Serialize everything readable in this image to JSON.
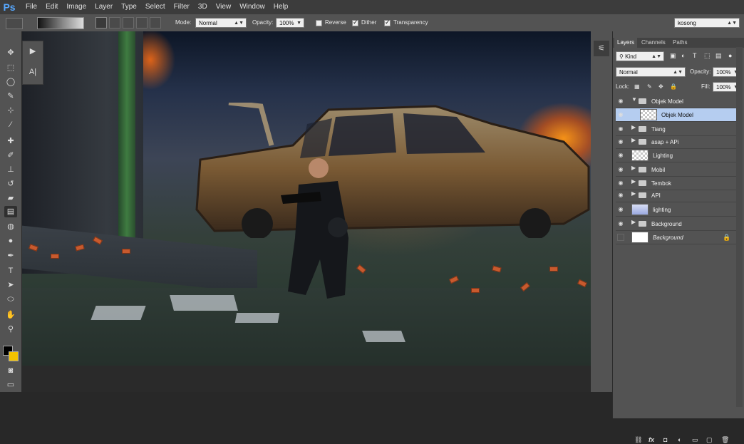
{
  "app": {
    "logo": "Ps"
  },
  "menu": [
    "File",
    "Edit",
    "Image",
    "Layer",
    "Type",
    "Select",
    "Filter",
    "3D",
    "View",
    "Window",
    "Help"
  ],
  "options": {
    "mode_label": "Mode:",
    "mode_value": "Normal",
    "opacity_label": "Opacity:",
    "opacity_value": "100%",
    "reverse_label": "Reverse",
    "dither_label": "Dither",
    "transparency_label": "Transparency",
    "reverse_checked": false,
    "dither_checked": true,
    "transparency_checked": true,
    "workspace_value": "kosong"
  },
  "layers_panel": {
    "tabs": [
      "Layers",
      "Channels",
      "Paths"
    ],
    "filter_value": "Kind",
    "blend_value": "Normal",
    "opacity_label": "Opacity:",
    "opacity_value": "100%",
    "lock_label": "Lock:",
    "fill_label": "Fill:",
    "fill_value": "100%",
    "layers": [
      {
        "name": "Objek Model",
        "type": "group",
        "expanded": true,
        "visible": true,
        "indent": 0
      },
      {
        "name": "Objek Model",
        "type": "layer",
        "selected": true,
        "visible": true,
        "indent": 1
      },
      {
        "name": "Tiang",
        "type": "group",
        "visible": true,
        "indent": 0
      },
      {
        "name": "asap + APi",
        "type": "group",
        "visible": true,
        "indent": 0
      },
      {
        "name": "Lighting",
        "type": "layer",
        "visible": true,
        "indent": 0
      },
      {
        "name": "Mobil",
        "type": "group",
        "visible": true,
        "indent": 0
      },
      {
        "name": "Tembok",
        "type": "group",
        "visible": true,
        "indent": 0
      },
      {
        "name": "API",
        "type": "group",
        "visible": true,
        "indent": 0
      },
      {
        "name": "lighting",
        "type": "layer",
        "visible": true,
        "indent": 0
      },
      {
        "name": "Background",
        "type": "group",
        "visible": true,
        "indent": 0
      },
      {
        "name": "Background",
        "type": "background",
        "visible": false,
        "locked": true,
        "indent": 0
      }
    ],
    "bottom_icons": [
      "link-icon",
      "fx-icon",
      "mask-icon",
      "adjustment-icon",
      "group-icon",
      "new-layer-icon",
      "trash-icon"
    ]
  },
  "colors": {
    "foreground": "#000000",
    "background": "#f2c200",
    "accent": "#57a8ff",
    "selection": "#b5cdf0"
  }
}
